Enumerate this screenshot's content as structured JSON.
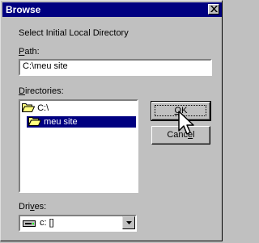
{
  "dialog": {
    "title": "Browse",
    "intro": "Select Initial Local Directory"
  },
  "path": {
    "label_mnemonic": "P",
    "label_rest": "ath:",
    "value": "C:\\meu site"
  },
  "directories": {
    "label_mnemonic": "D",
    "label_rest": "irectories:",
    "items": [
      {
        "label": "C:\\",
        "icon": "open-folder-icon"
      },
      {
        "label": "meu site",
        "icon": "open-folder-icon",
        "selected": true
      }
    ]
  },
  "buttons": {
    "ok": {
      "mnemonic": "O",
      "rest": "K"
    },
    "cancel": {
      "pre": "Canc",
      "mnemonic": "e",
      "post": "l"
    }
  },
  "drives": {
    "label_pre": "Dri",
    "label_mnemonic": "v",
    "label_post": "es:",
    "value": "c: []"
  },
  "colors": {
    "titlebar": "#000080",
    "selection": "#000080",
    "face": "#c0c0c0"
  }
}
